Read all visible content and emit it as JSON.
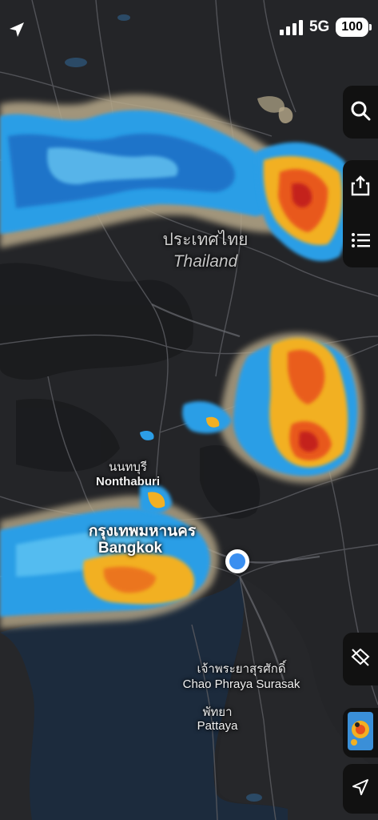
{
  "status_bar": {
    "network": "5G",
    "battery": "100"
  },
  "labels": {
    "country_thai": "ประเทศไทย",
    "country_en": "Thailand",
    "nonthaburi_thai": "นนทบุรี",
    "nonthaburi_en": "Nonthaburi",
    "bangkok_thai": "กรุงเทพมหานคร",
    "bangkok_en": "Bangkok",
    "surasak_thai": "เจ้าพระยาสุรศักดิ์",
    "surasak_en": "Chao Phraya Surasak",
    "pattaya_thai": "พัทยา",
    "pattaya_en": "Pattaya"
  },
  "controls": [
    {
      "name": "search-button",
      "icon": "search-icon"
    },
    {
      "name": "share-button",
      "icon": "share-icon"
    },
    {
      "name": "list-button",
      "icon": "list-icon"
    },
    {
      "name": "layers-button",
      "icon": "layers-icon"
    },
    {
      "name": "map-thumbnail-button",
      "icon": "radar-thumbnail-icon"
    },
    {
      "name": "locate-button",
      "icon": "location-arrow-icon"
    }
  ],
  "colors": {
    "land": "#26272a",
    "sea": "#1b2a3c",
    "roads": "#4a4b4f",
    "rain_light": "#2a8fd8",
    "rain_medium": "#1a5fb0",
    "rain_heavy": "#f0b020",
    "rain_extreme": "#d62a1a",
    "location": "#3a8ff0"
  }
}
